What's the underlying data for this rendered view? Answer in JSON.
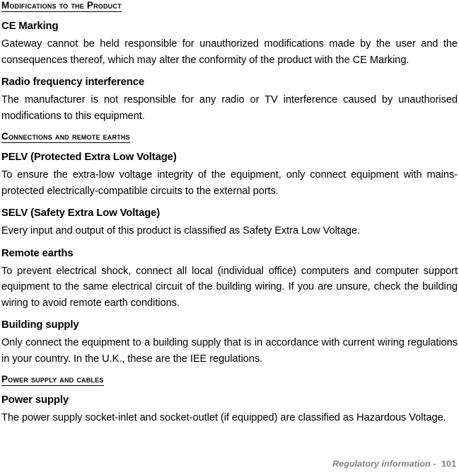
{
  "document": {
    "sections": [
      {
        "type": "section-header",
        "text": "Modifications to the Product"
      },
      {
        "type": "sub-heading",
        "text": "CE Marking"
      },
      {
        "type": "paragraph",
        "text": "Gateway cannot be held responsible for unauthorized modifications made by the user and the consequences thereof, which may alter the conformity of the product with the CE Marking."
      },
      {
        "type": "sub-heading",
        "text": "Radio frequency interference"
      },
      {
        "type": "paragraph",
        "text": "The manufacturer is not responsible for any radio or TV interference caused by unauthorised modifications to this equipment."
      },
      {
        "type": "section-header",
        "text": "Connections and remote earths"
      },
      {
        "type": "sub-heading",
        "text": "PELV (Protected Extra Low Voltage)"
      },
      {
        "type": "paragraph",
        "text": "To ensure the extra-low voltage integrity of the equipment, only connect equipment with mains-protected electrically-compatible circuits to the external ports."
      },
      {
        "type": "sub-heading",
        "text": "SELV (Safety Extra Low Voltage)"
      },
      {
        "type": "paragraph-single",
        "text": "Every input and output of this product is classified as Safety Extra Low Voltage."
      },
      {
        "type": "sub-heading",
        "text": "Remote earths"
      },
      {
        "type": "paragraph",
        "text": "To prevent electrical shock, connect all local (individual office) computers and computer support equipment to the same electrical circuit of the building wiring. If you are unsure, check the building wiring to avoid remote earth conditions."
      },
      {
        "type": "sub-heading",
        "text": "Building supply"
      },
      {
        "type": "paragraph",
        "text": "Only connect the equipment to a building supply that is in accordance with current wiring regulations in your country. In the U.K., these are the IEE regulations."
      },
      {
        "type": "section-header",
        "text": "Power supply and cables"
      },
      {
        "type": "sub-heading",
        "text": "Power supply"
      },
      {
        "type": "paragraph",
        "text": "The power supply socket-inlet and socket-outlet (if equipped) are classified as Hazardous Voltage."
      }
    ]
  },
  "footer": {
    "chapter": "Regulatory information",
    "separator": "-",
    "page_number": "101",
    "color": "#808080"
  }
}
